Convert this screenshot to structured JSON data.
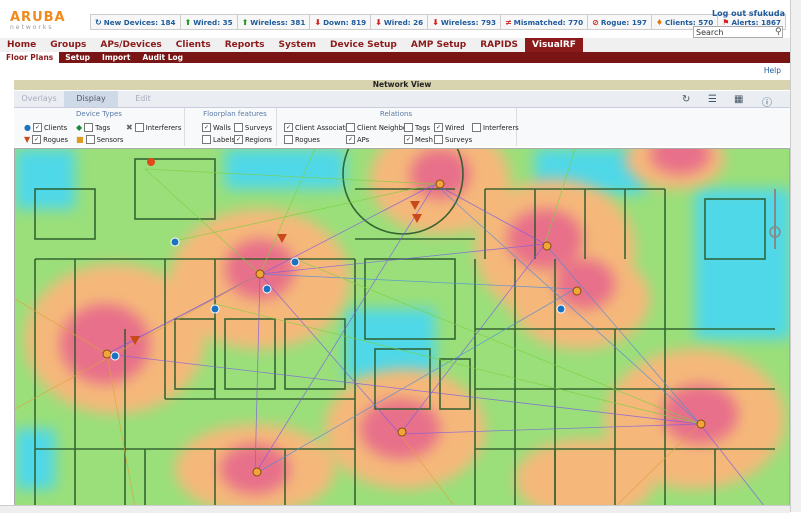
{
  "logo": {
    "name": "ARUBA",
    "sub": "networks"
  },
  "status": [
    {
      "icon": "refresh-icon",
      "label": "New Devices: 184",
      "color": "#205c9c"
    },
    {
      "icon": "arrow-up-icon",
      "label": "Wired: 35",
      "color": "#2a9a2a"
    },
    {
      "icon": "arrow-up-icon",
      "label": "Wireless: 381",
      "color": "#2a9a2a"
    },
    {
      "icon": "arrow-down-icon",
      "label": "Down: 819",
      "color": "#d02020"
    },
    {
      "icon": "arrow-down-icon",
      "label": "Wired: 26",
      "color": "#d02020"
    },
    {
      "icon": "arrow-down-icon",
      "label": "Wireless: 793",
      "color": "#d02020"
    },
    {
      "icon": "mismatch-icon",
      "label": "Mismatched: 770",
      "color": "#d02020"
    },
    {
      "icon": "rogue-icon",
      "label": "Rogue: 197",
      "color": "#d02020"
    },
    {
      "icon": "client-icon",
      "label": "Clients: 570",
      "color": "#e07a10"
    },
    {
      "icon": "alert-icon",
      "label": "Alerts: 1867",
      "color": "#d02020"
    }
  ],
  "header": {
    "logout": "Log out sfukuda",
    "search_value": "Search"
  },
  "main_nav": [
    "Home",
    "Groups",
    "APs/Devices",
    "Clients",
    "Reports",
    "System",
    "Device Setup",
    "AMP Setup",
    "RAPIDS",
    "VisualRF"
  ],
  "main_nav_active": 9,
  "sub_nav": [
    "Floor Plans",
    "Setup",
    "Import",
    "Audit Log"
  ],
  "sub_nav_active": 0,
  "help": "Help",
  "network_view": {
    "title": "Network View",
    "tabs": [
      "Overlays",
      "Display",
      "Edit"
    ],
    "active_tab": 1
  },
  "filters": {
    "device_types": {
      "title": "Device Types",
      "items": {
        "clients": "Clients",
        "tags": "Tags",
        "interferers": "Interferers",
        "rogues": "Rogues",
        "sensors": "Sensors"
      }
    },
    "floorplan": {
      "title": "Floorplan features",
      "items": {
        "walls": "Walls",
        "surveys": "Surveys",
        "labels": "Labels",
        "regions": "Regions"
      }
    },
    "relations": {
      "title": "Relations",
      "items": {
        "client_association": "Client Association",
        "client_neighbors": "Client Neighbors",
        "tags": "Tags",
        "wired": "Wired",
        "interferers": "Interferers",
        "rogues": "Rogues",
        "aps": "APs",
        "mesh": "Mesh",
        "surveys": "Surveys"
      }
    }
  },
  "colors": {
    "brand": "#8b1a1a",
    "heat_red": "#e8708a",
    "heat_orange": "#f5b87a",
    "heat_green": "#9adf7a",
    "heat_cyan": "#4fd8e8"
  }
}
